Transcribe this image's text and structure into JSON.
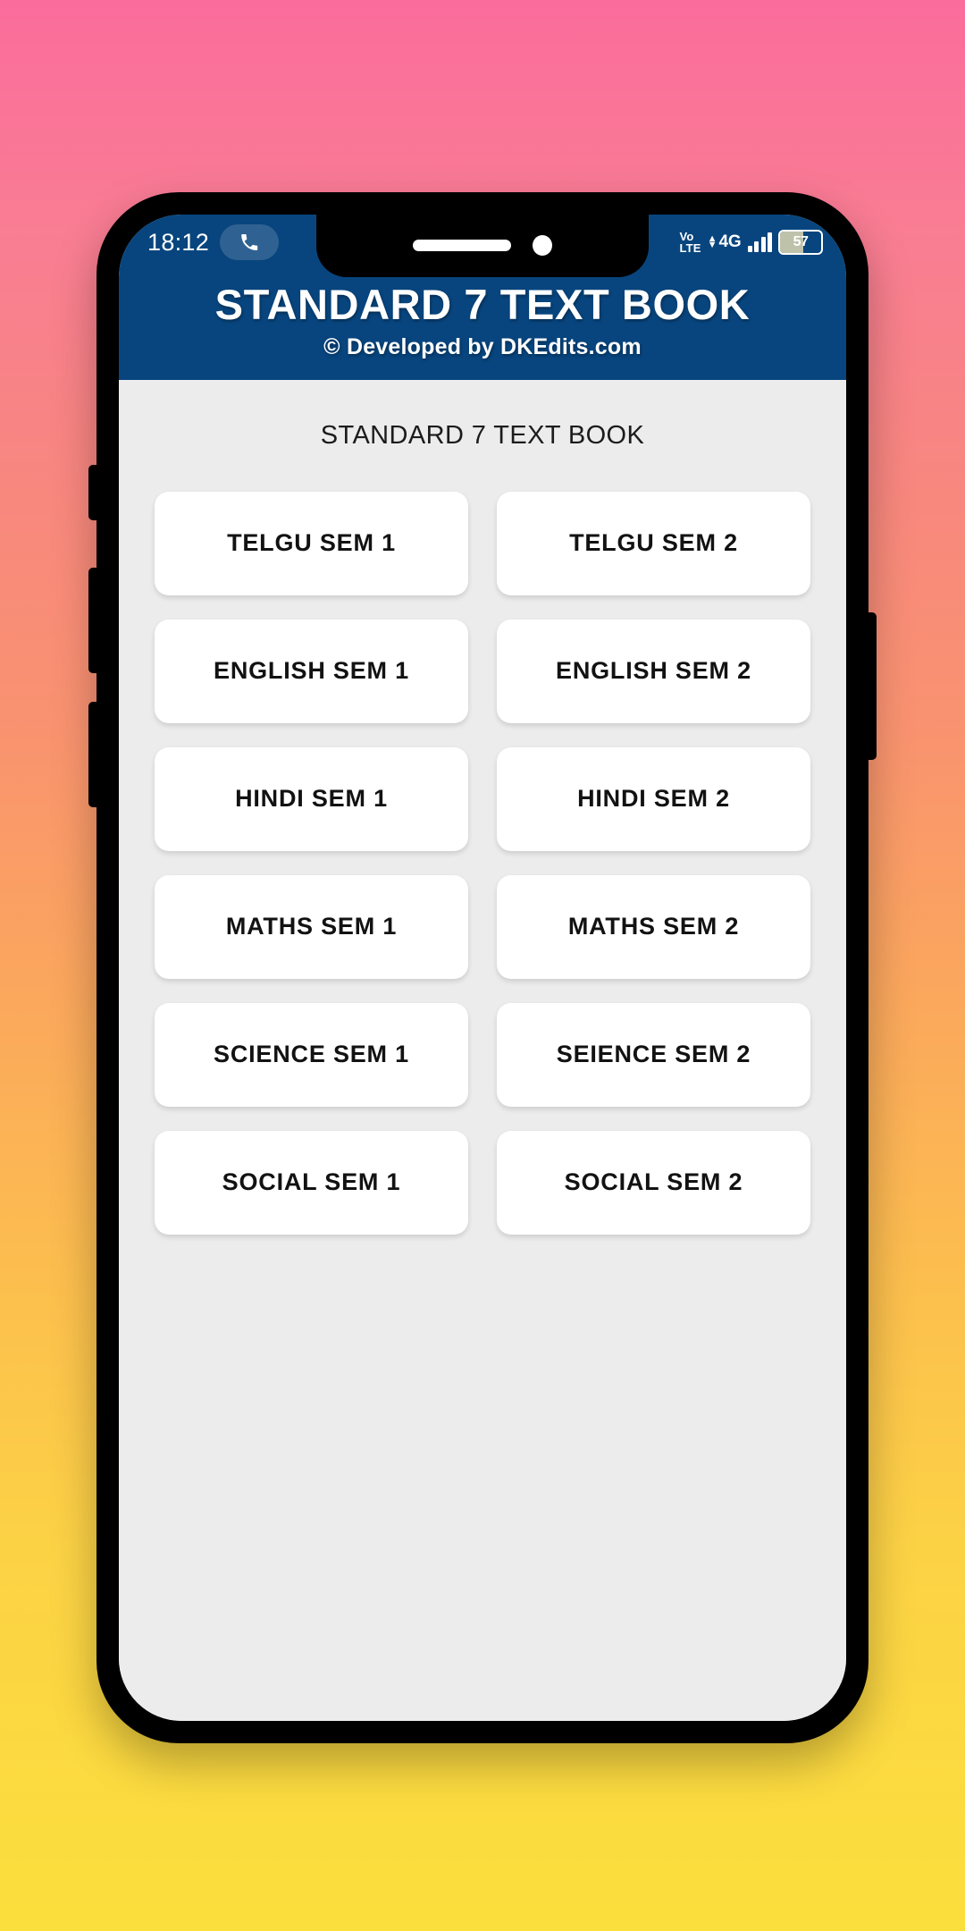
{
  "status_bar": {
    "time": "18:12",
    "call_icon": "phone-call-icon",
    "volte_top": "Vo",
    "volte_bottom": "LTE",
    "data_arrows": "⇅",
    "network": "4G",
    "signal_icon": "signal-bars-icon",
    "battery_level": "57"
  },
  "app_bar": {
    "title": "STANDARD 7 TEXT BOOK",
    "subtitle": "© Developed by DKEdits.com"
  },
  "main": {
    "section_title": "STANDARD 7 TEXT BOOK",
    "tiles": [
      {
        "label": "TELGU SEM 1"
      },
      {
        "label": "TELGU SEM 2"
      },
      {
        "label": "ENGLISH SEM 1"
      },
      {
        "label": "ENGLISH SEM 2"
      },
      {
        "label": "HINDI SEM 1"
      },
      {
        "label": "HINDI SEM 2"
      },
      {
        "label": "MATHS SEM 1"
      },
      {
        "label": "MATHS SEM 2"
      },
      {
        "label": "SCIENCE SEM 1"
      },
      {
        "label": "SEIENCE SEM 2"
      },
      {
        "label": "SOCIAL SEM 1"
      },
      {
        "label": "SOCIAL SEM 2"
      }
    ]
  },
  "colors": {
    "app_bar_blue": "#08457E",
    "screen_background": "#ECECEC",
    "tile_background": "#FFFFFF",
    "tile_text": "#121212",
    "wallpaper_top": "#FA6C9C",
    "wallpaper_bottom": "#FBDF3C",
    "phone_frame": "#000000"
  }
}
